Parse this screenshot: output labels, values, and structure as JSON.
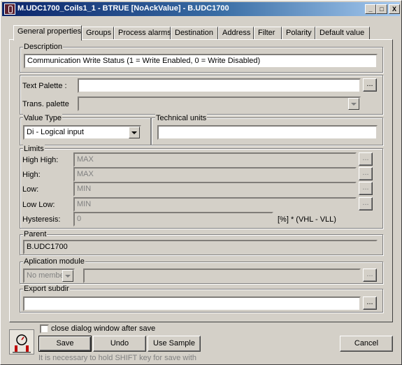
{
  "window": {
    "title": "M.UDC1700_Coils1_1 - BTRUE [NoAckValue] - B.UDC1700",
    "minimize": "_",
    "maximize": "□",
    "close": "X"
  },
  "tabs": [
    {
      "label": "General properties",
      "active": true
    },
    {
      "label": "Groups"
    },
    {
      "label": "Process alarms"
    },
    {
      "label": "Destination"
    },
    {
      "label": "Address"
    },
    {
      "label": "Filter"
    },
    {
      "label": "Polarity"
    },
    {
      "label": "Default value"
    }
  ],
  "description": {
    "label": "Description",
    "value": "Communication Write Status (1 = Write Enabled, 0 = Write Disabled)"
  },
  "text_palette": {
    "label": "Text Palette :",
    "value": "",
    "browse": "..."
  },
  "trans_palette": {
    "label": "Trans. palette",
    "value": ""
  },
  "value_type": {
    "label": "Value Type",
    "selected": "Di - Logical input"
  },
  "technical_units": {
    "label": "Technical units",
    "value": ""
  },
  "limits": {
    "label": "Limits",
    "rows": [
      {
        "label": "High High:",
        "value": "MAX",
        "browse": "..."
      },
      {
        "label": "High:",
        "value": "MAX",
        "browse": "..."
      },
      {
        "label": "Low:",
        "value": "MIN",
        "browse": "..."
      },
      {
        "label": "Low Low:",
        "value": "MIN",
        "browse": "..."
      }
    ],
    "hysteresis": {
      "label": "Hysteresis:",
      "value": "0",
      "unit": "[%] * (VHL - VLL)"
    }
  },
  "parent": {
    "label": "Parent",
    "value": "B.UDC1700"
  },
  "application_module": {
    "label": "Aplication module",
    "selected": "No member",
    "value": "",
    "browse": "..."
  },
  "export_subdir": {
    "label": "Export subdir",
    "value": "",
    "browse": "..."
  },
  "footer": {
    "close_after_save": "close dialog window after save",
    "save": "Save",
    "undo": "Undo",
    "use_sample": "Use Sample",
    "cancel": "Cancel",
    "hint": "It is necessary to hold SHIFT key for save with"
  }
}
